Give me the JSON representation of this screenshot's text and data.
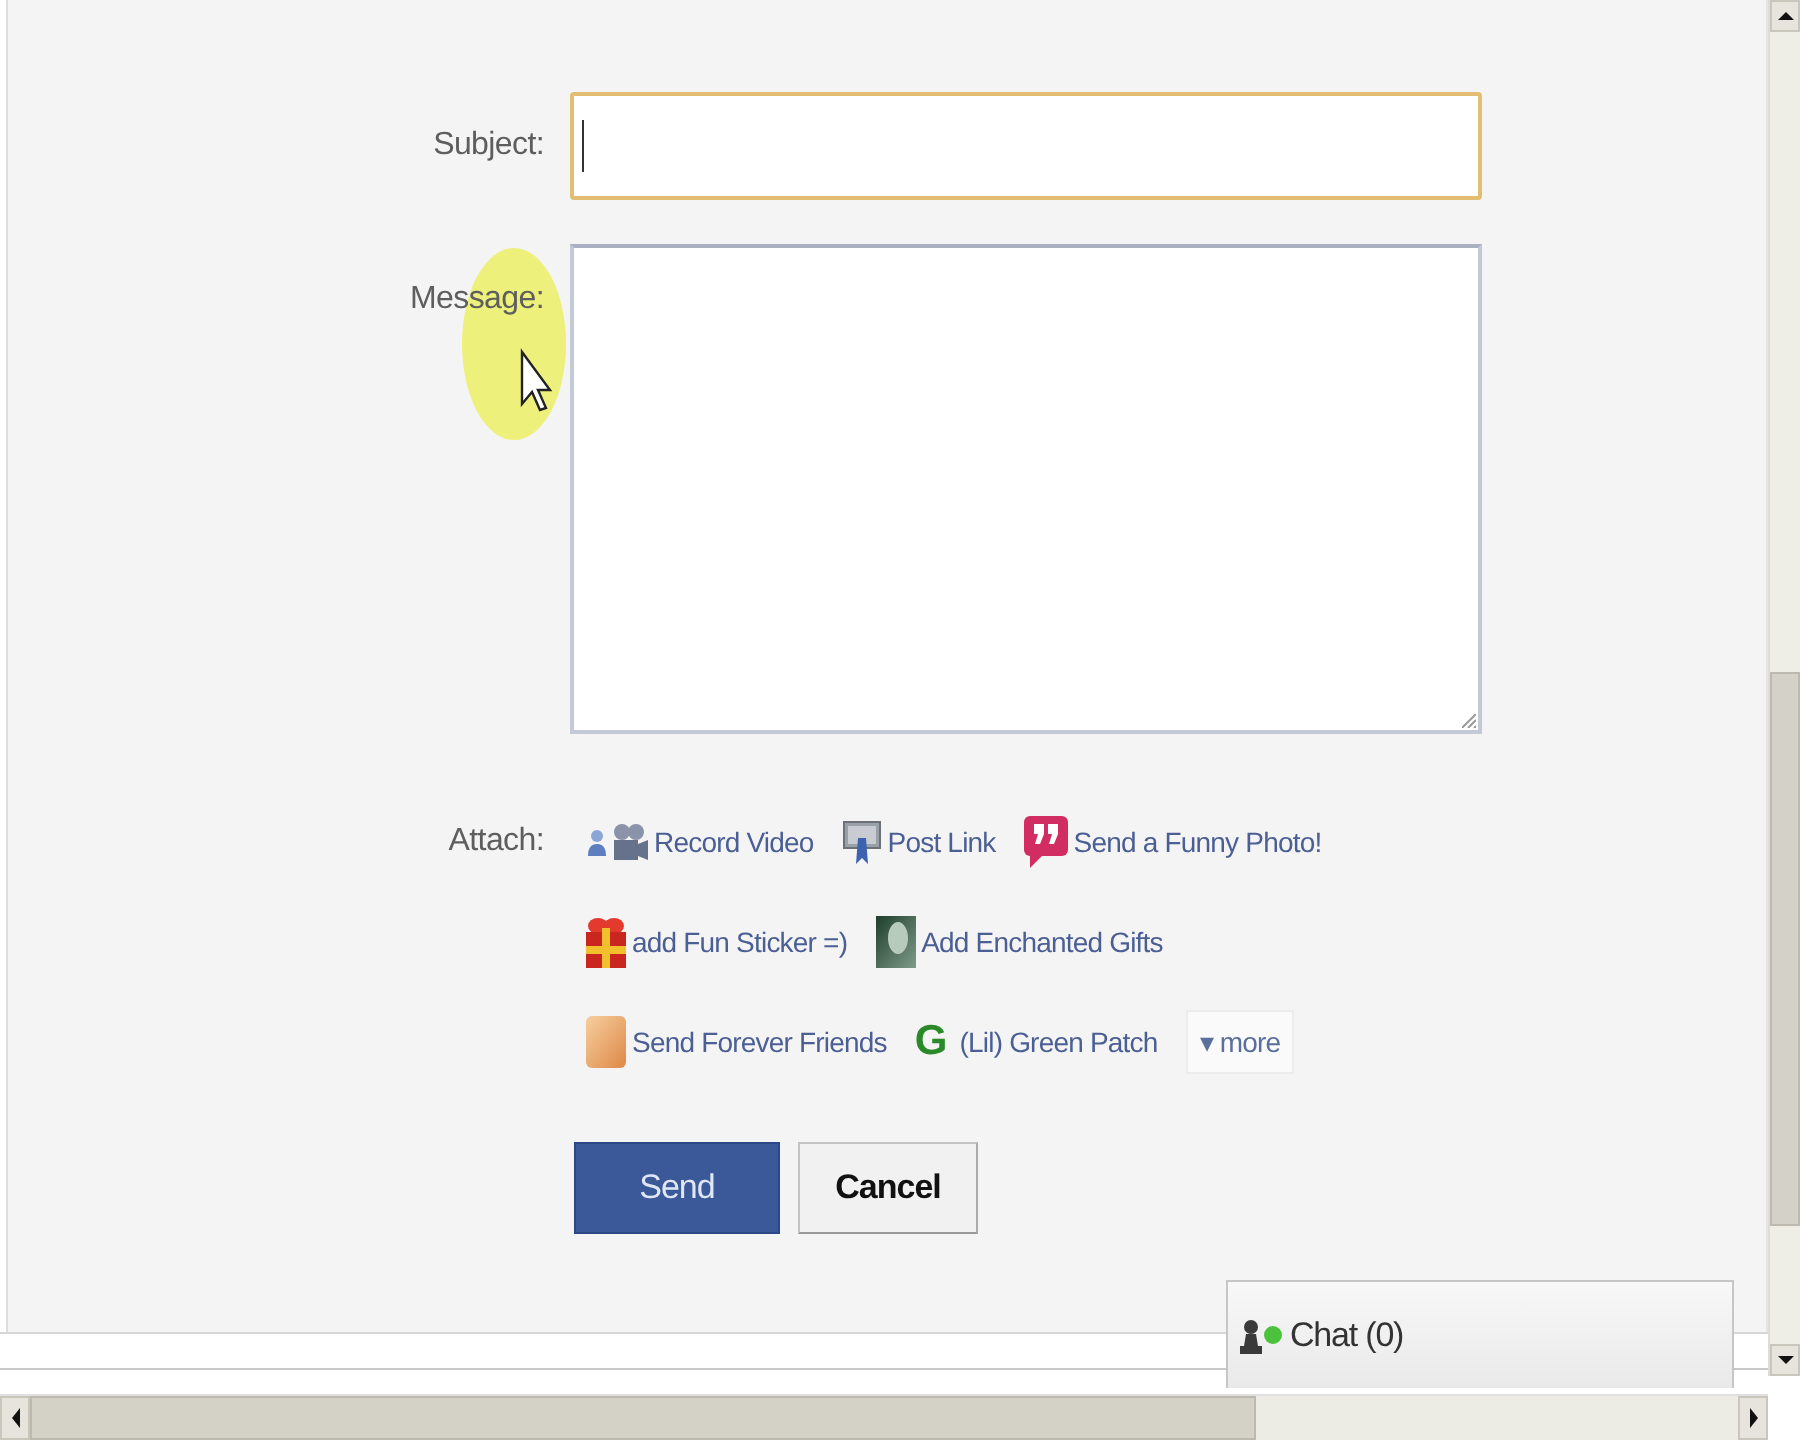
{
  "subject": {
    "label": "Subject:",
    "focused": true
  },
  "message": {
    "label": "Message:",
    "focused": false
  },
  "attach": {
    "label": "Attach:",
    "rows": [
      [
        {
          "kind": "video",
          "label": "Record Video"
        },
        {
          "kind": "link",
          "label": "Post Link"
        },
        {
          "kind": "funny-photo",
          "label": "Send a Funny Photo!"
        }
      ],
      [
        {
          "kind": "gift",
          "label": "add Fun Sticker =)"
        },
        {
          "kind": "enchanted",
          "label": "Add Enchanted Gifts"
        }
      ],
      [
        {
          "kind": "friends",
          "label": "Send Forever Friends"
        },
        {
          "kind": "letter",
          "glyph": "G",
          "label": "(Lil) Green Patch"
        },
        {
          "kind": "more",
          "label": "▾ more"
        }
      ]
    ]
  },
  "buttons": [
    {
      "kind": "primary",
      "label": "Send"
    },
    {
      "kind": "secondary",
      "label": "Cancel"
    }
  ],
  "chat": {
    "label": "Chat (0)",
    "online": true
  }
}
